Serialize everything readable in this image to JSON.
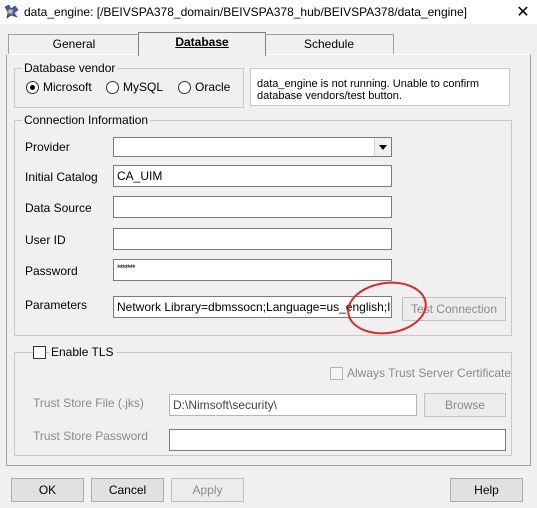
{
  "window": {
    "title": "data_engine: [/BEIVSPA378_domain/BEIVSPA378_hub/BEIVSPA378/data_engine]",
    "close_glyph": "✕"
  },
  "tabs": [
    {
      "label": "General"
    },
    {
      "label": "Database"
    },
    {
      "label": "Schedule"
    }
  ],
  "database_vendor": {
    "title": "Database vendor",
    "options": [
      {
        "label": "Microsoft",
        "checked": true
      },
      {
        "label": "MySQL",
        "checked": false
      },
      {
        "label": "Oracle",
        "checked": false
      }
    ],
    "message": "data_engine is not running. Unable to confirm database vendors/test button."
  },
  "connection": {
    "title": "Connection Information",
    "provider": {
      "label": "Provider",
      "value": ""
    },
    "initial_catalog": {
      "label": "Initial Catalog",
      "value": "CA_UIM"
    },
    "data_source": {
      "label": "Data Source",
      "value": ""
    },
    "user_id": {
      "label": "User ID",
      "value": ""
    },
    "password": {
      "label": "Password",
      "value": "*******"
    },
    "parameters": {
      "label": "Parameters",
      "value": "Network Library=dbmssocn;Language=us_english;Integrat"
    },
    "test_button": "Test Connection"
  },
  "tls": {
    "enable_label": "Enable TLS",
    "always_trust_label": "Always Trust Server Certificate",
    "trust_store_file": {
      "label": "Trust Store File (.jks)",
      "value": "D:\\Nimsoft\\security\\"
    },
    "browse_button": "Browse",
    "trust_store_password": {
      "label": "Trust Store Password",
      "value": ""
    }
  },
  "footer": {
    "ok": "OK",
    "cancel": "Cancel",
    "apply": "Apply",
    "help": "Help"
  },
  "colors": {
    "annotation_circle": "#e0242a"
  }
}
